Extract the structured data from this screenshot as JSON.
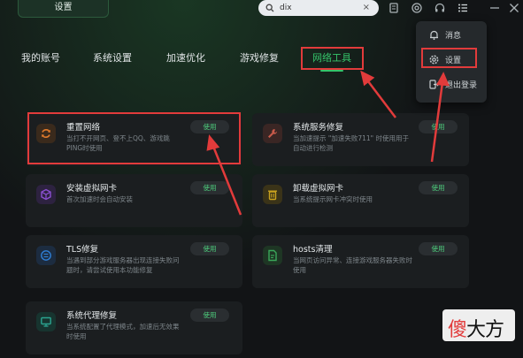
{
  "topbar": {
    "tab_label": "设置",
    "search_value": "dix",
    "search_clear": "×"
  },
  "nav": {
    "tabs": [
      {
        "label": "我的账号"
      },
      {
        "label": "系统设置"
      },
      {
        "label": "加速优化"
      },
      {
        "label": "游戏修复"
      },
      {
        "label": "网络工具"
      }
    ],
    "active_index": 4
  },
  "cards": [
    {
      "title": "重置网络",
      "desc": "当打不开网页、登不上QQ、游戏跳PING时使用",
      "button": "使用",
      "icon": "refresh-icon",
      "color": "#e07a2c"
    },
    {
      "title": "系统服务修复",
      "desc": "当加速提示 \"加速失败711\" 时使用用于自动进行检测",
      "button": "使用",
      "icon": "wrench-icon",
      "color": "#c85a4a"
    },
    {
      "title": "安装虚拟网卡",
      "desc": "首次加速时会自动安装",
      "button": "使用",
      "icon": "cube-icon",
      "color": "#8a4fd0"
    },
    {
      "title": "卸载虚拟网卡",
      "desc": "当系统提示网卡冲突时使用",
      "button": "使用",
      "icon": "trash-icon",
      "color": "#c9a21e"
    },
    {
      "title": "TLS修复",
      "desc": "当遇到部分游戏服务器出现连接失败问题时，请尝试使用本功能修复",
      "button": "使用",
      "icon": "shield-cycle-icon",
      "color": "#2f7fd6"
    },
    {
      "title": "hosts清理",
      "desc": "当网页访问异常、连接游戏服务器失败时使用",
      "button": "使用",
      "icon": "document-icon",
      "color": "#3aa85a"
    },
    {
      "title": "系统代理修复",
      "desc": "当系统配置了代理模式，加速后无效果时使用",
      "button": "使用",
      "icon": "monitor-icon",
      "color": "#2ba38f"
    }
  ],
  "menu": {
    "items": [
      {
        "label": "消息",
        "icon": "bell-icon"
      },
      {
        "label": "设置",
        "icon": "gear-icon"
      },
      {
        "label": "退出登录",
        "icon": "logout-icon"
      }
    ]
  },
  "watermark": {
    "text_first": "傻",
    "text_rest": "大方"
  }
}
